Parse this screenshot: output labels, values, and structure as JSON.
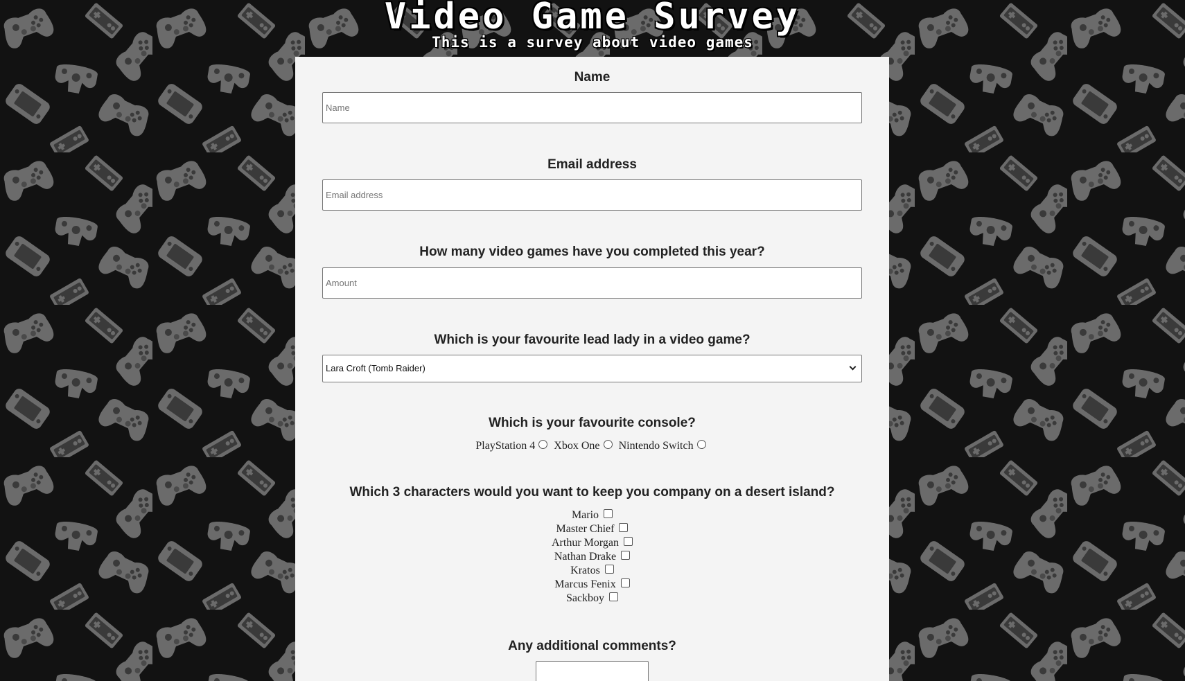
{
  "header": {
    "title": "Video Game Survey",
    "subtitle": "This is a survey about video games"
  },
  "form": {
    "name": {
      "label": "Name",
      "placeholder": "Name",
      "value": ""
    },
    "email": {
      "label": "Email address",
      "placeholder": "Email address",
      "value": ""
    },
    "count": {
      "label": "How many video games have you completed this year?",
      "placeholder": "Amount",
      "value": ""
    },
    "lead_lady": {
      "label": "Which is your favourite lead lady in a video game?",
      "selected": "Lara Croft (Tomb Raider)"
    },
    "console": {
      "label": "Which is your favourite console?",
      "options": [
        "PlayStation 4",
        "Xbox One",
        "Nintendo Switch"
      ]
    },
    "characters": {
      "label": "Which 3 characters would you want to keep you company on a desert island?",
      "options": [
        "Mario",
        "Master Chief",
        "Arthur Morgan",
        "Nathan Drake",
        "Kratos",
        "Marcus Fenix",
        "Sackboy"
      ]
    },
    "comments": {
      "label": "Any additional comments?"
    }
  },
  "colors": {
    "background": "#121212",
    "pattern": "#6b6b6b",
    "panel": "#f4f4f4"
  },
  "icons": {
    "background_pattern": "game-controller-icons"
  }
}
